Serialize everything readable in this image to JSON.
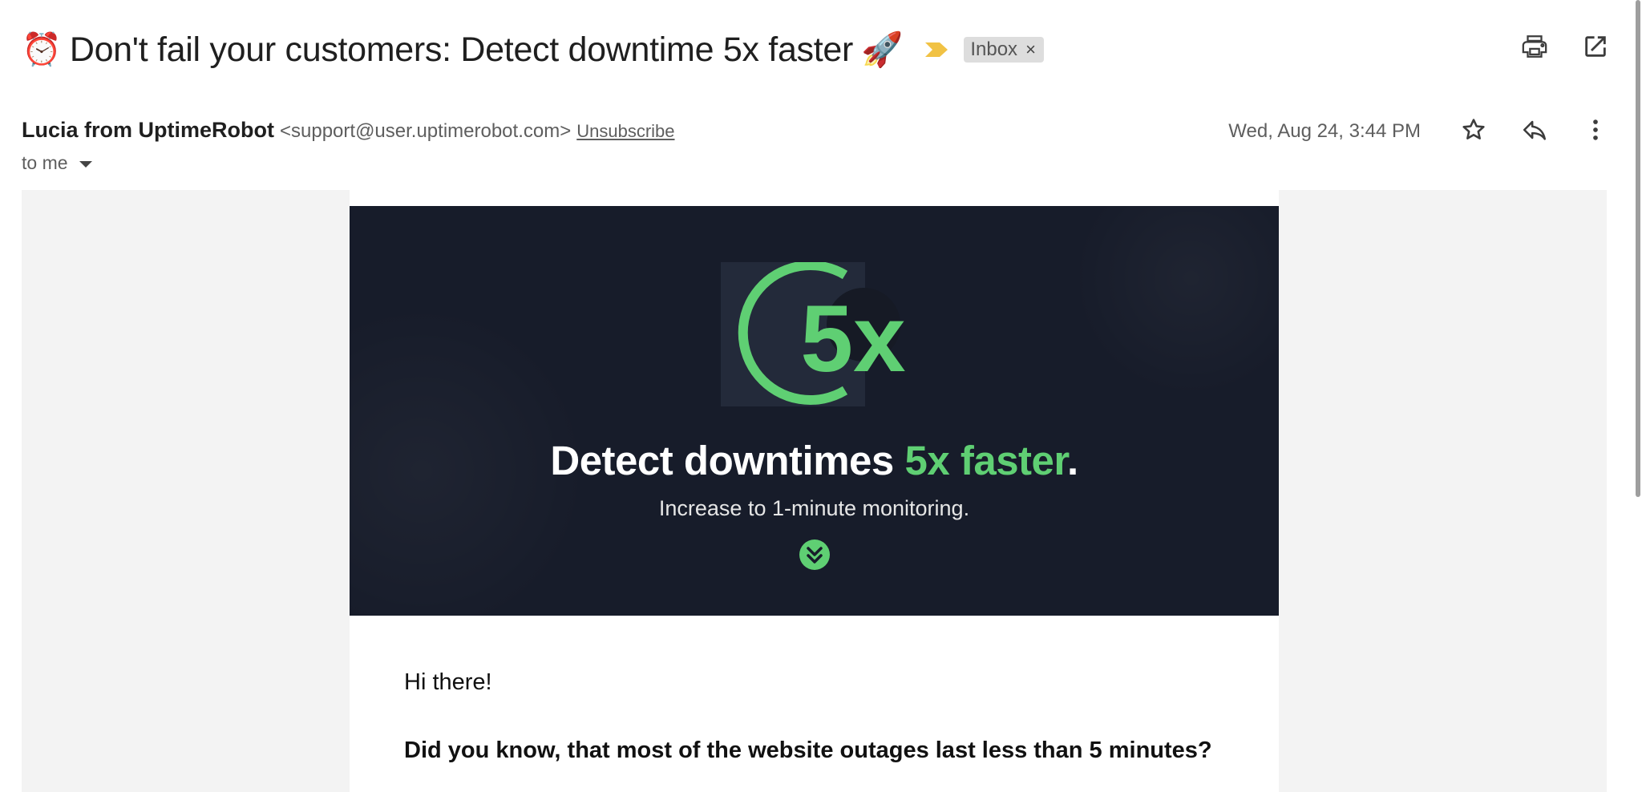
{
  "subject": {
    "emoji_start": "⏰",
    "text": "Don't fail your customers: Detect downtime 5x faster",
    "emoji_end": "🚀",
    "label": "Inbox",
    "label_close": "×"
  },
  "toolbar": {
    "print_icon": "print-icon",
    "open_new_window_icon": "open-in-new-icon"
  },
  "sender": {
    "name": "Lucia from UptimeRobot",
    "email": "<support@user.uptimerobot.com>",
    "unsubscribe": "Unsubscribe"
  },
  "recipient": {
    "text": "to me"
  },
  "message": {
    "date": "Wed, Aug 24, 3:44 PM"
  },
  "hero": {
    "title_main": "Detect downtimes ",
    "title_accent": "5x faster",
    "title_period": ".",
    "subtitle": "Increase to 1-minute monitoring.",
    "logo_text": "5x"
  },
  "content": {
    "greeting": "Hi there!",
    "question": "Did you know, that most of the website outages last less than 5 minutes?"
  },
  "colors": {
    "accent_green": "#5fcf73",
    "hero_bg": "#171c2a",
    "importance_yellow": "#f1c244",
    "body_bg": "#f3f3f3"
  }
}
